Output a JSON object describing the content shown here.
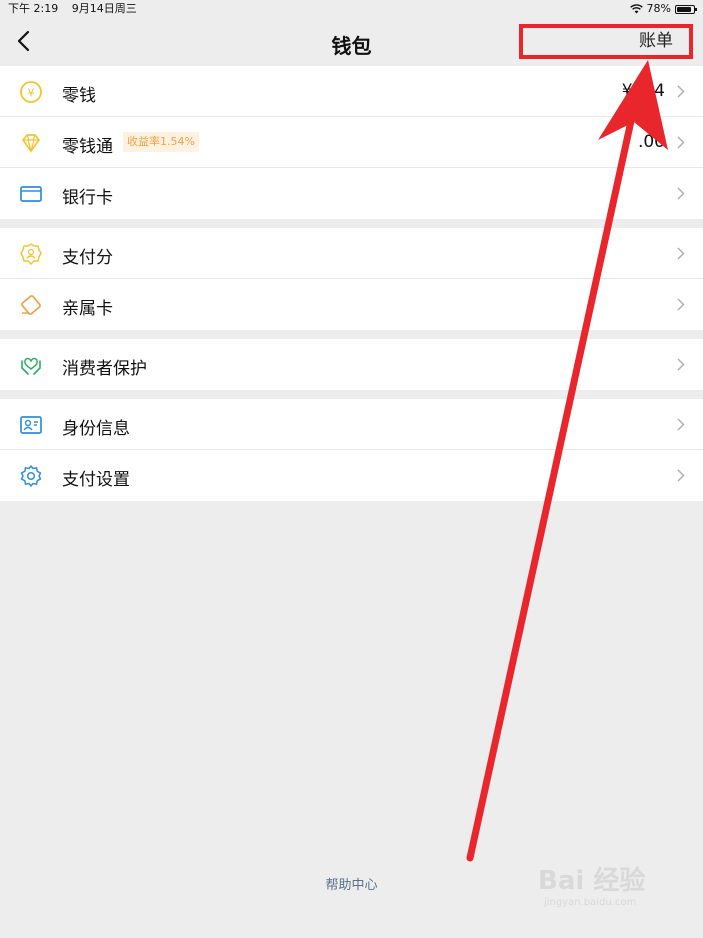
{
  "status_bar": {
    "time": "下午 2:19",
    "date": "9月14日周三",
    "battery": "78%"
  },
  "nav": {
    "title": "钱包",
    "bill_label": "账单"
  },
  "groups": [
    {
      "items": [
        {
          "label": "零钱",
          "value": "¥9 .4",
          "icon": "yuan-coin-icon"
        },
        {
          "label": "零钱通",
          "badge": "收益率1.54%",
          "value": ".00",
          "icon": "diamond-icon"
        },
        {
          "label": "银行卡",
          "icon": "bank-card-icon"
        }
      ]
    },
    {
      "items": [
        {
          "label": "支付分",
          "icon": "badge-icon"
        },
        {
          "label": "亲属卡",
          "icon": "family-card-icon"
        }
      ]
    },
    {
      "items": [
        {
          "label": "消费者保护",
          "icon": "protect-hands-icon"
        }
      ]
    },
    {
      "items": [
        {
          "label": "身份信息",
          "icon": "id-card-icon"
        },
        {
          "label": "支付设置",
          "icon": "settings-gear-icon"
        }
      ]
    }
  ],
  "footer": {
    "help_center": "帮助中心"
  },
  "watermark": {
    "brand": "Bai 经验",
    "url": "jingyan.baidu.com"
  },
  "colors": {
    "annotation_red": "#e8262b",
    "accent_gold": "#f4c430",
    "accent_blue": "#2f8fd8",
    "accent_green": "#2bae66",
    "accent_orange": "#f0a24a"
  }
}
